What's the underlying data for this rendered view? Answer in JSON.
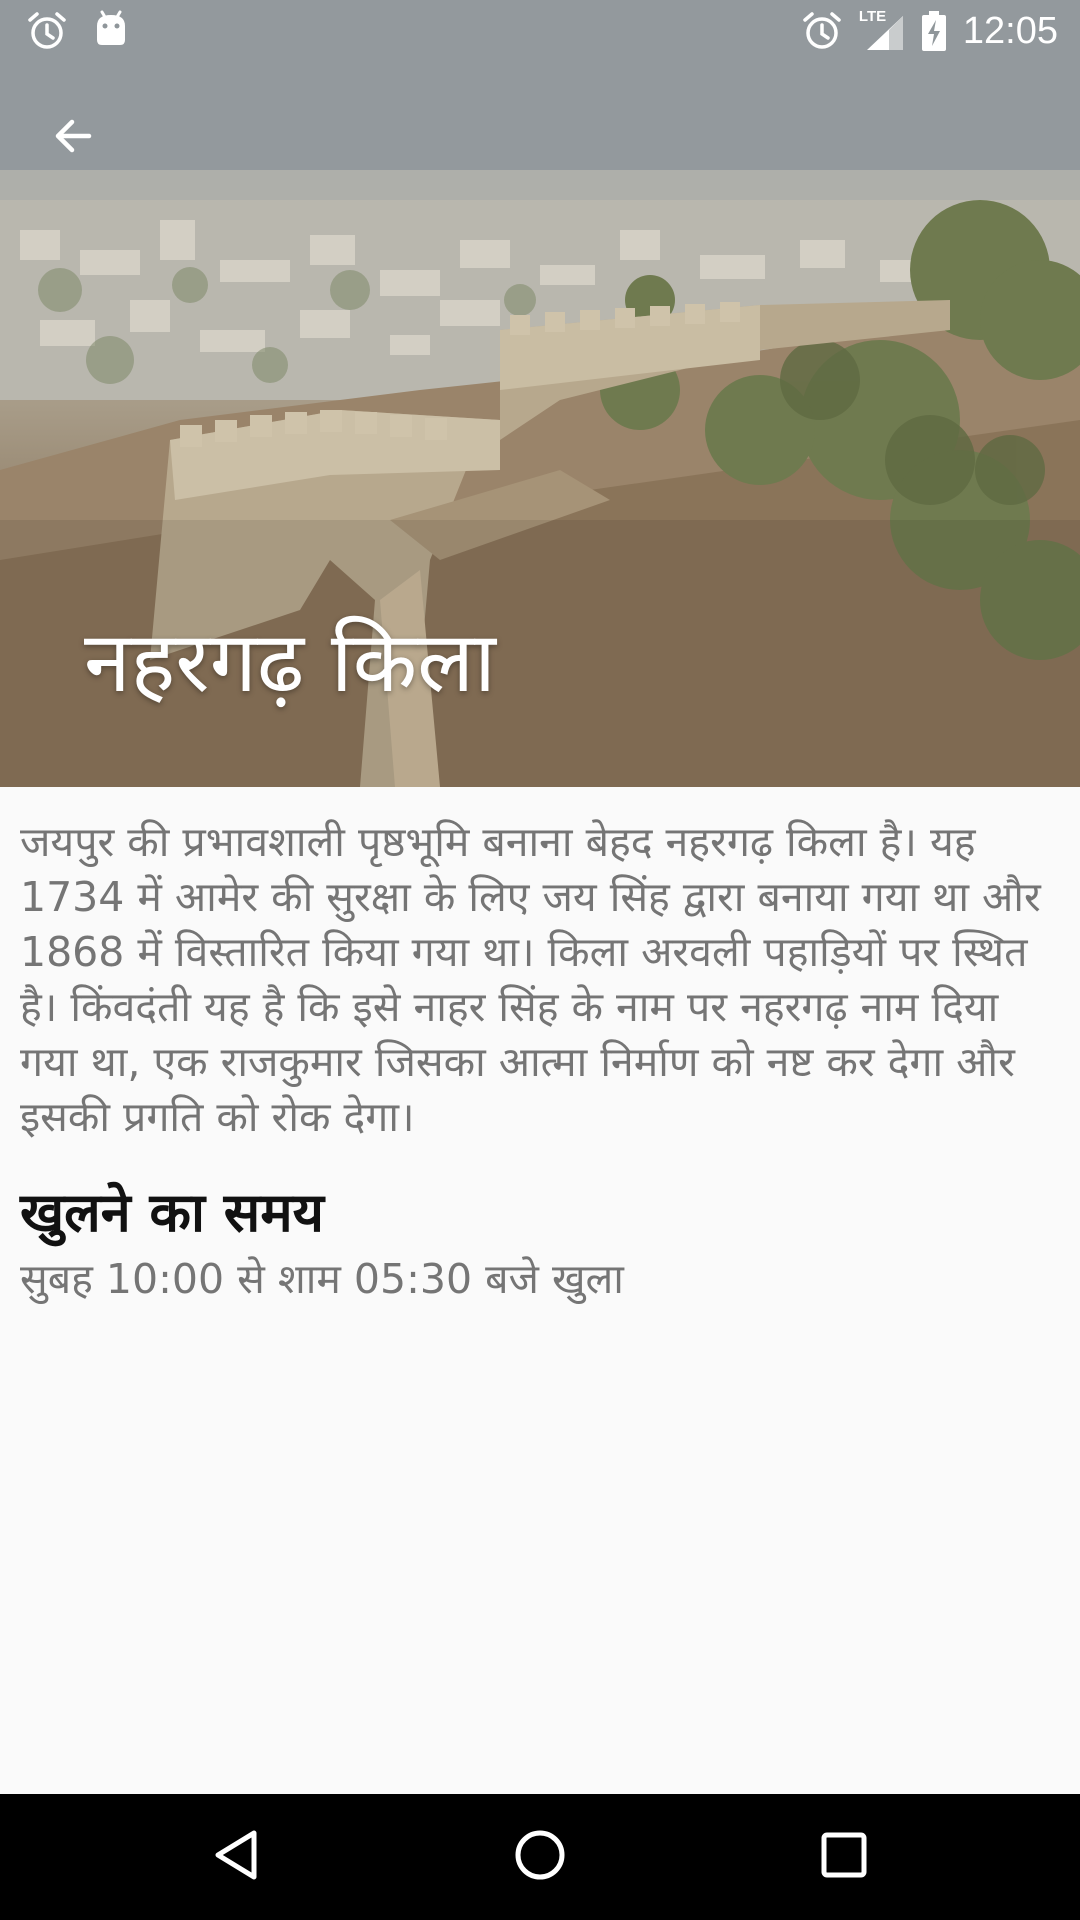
{
  "status_bar": {
    "time": "12:05",
    "network": "LTE",
    "left_icons": [
      "alarm-icon",
      "android-icon"
    ],
    "right_icons": [
      "alarm-icon",
      "signal-icon",
      "battery-charging-icon"
    ]
  },
  "toolbar": {
    "back_icon": "arrow-back-icon",
    "title": "नहरगढ़ किला"
  },
  "hero_image": {
    "subject": "fort-wall-photo"
  },
  "content": {
    "description": "जयपुर की प्रभावशाली पृष्ठभूमि बनाना बेहद नहरगढ़ किला है। यह 1734 में आमेर की सुरक्षा के लिए जय सिंह द्वारा बनाया गया था और 1868 में विस्तारित किया गया था। किला अरवली पहाड़ियों पर स्थित है। किंवदंती यह है कि इसे नाहर सिंह के नाम पर नहरगढ़ नाम दिया गया था, एक राजकुमार जिसका आत्मा निर्माण को नष्ट कर देगा और इसकी प्रगति को रोक देगा।",
    "timing_heading": "खुलने का समय",
    "timing_value": "सुबह 10:00 से शाम 05:30 बजे खुला"
  },
  "navigation_bar": {
    "buttons": [
      "back-triangle-icon",
      "home-circle-icon",
      "recents-square-icon"
    ]
  },
  "colors": {
    "background": "#fafafa",
    "body_text": "#757575",
    "heading_text": "#111111",
    "nav_bar": "#000000",
    "overlay_text": "#ffffff"
  }
}
